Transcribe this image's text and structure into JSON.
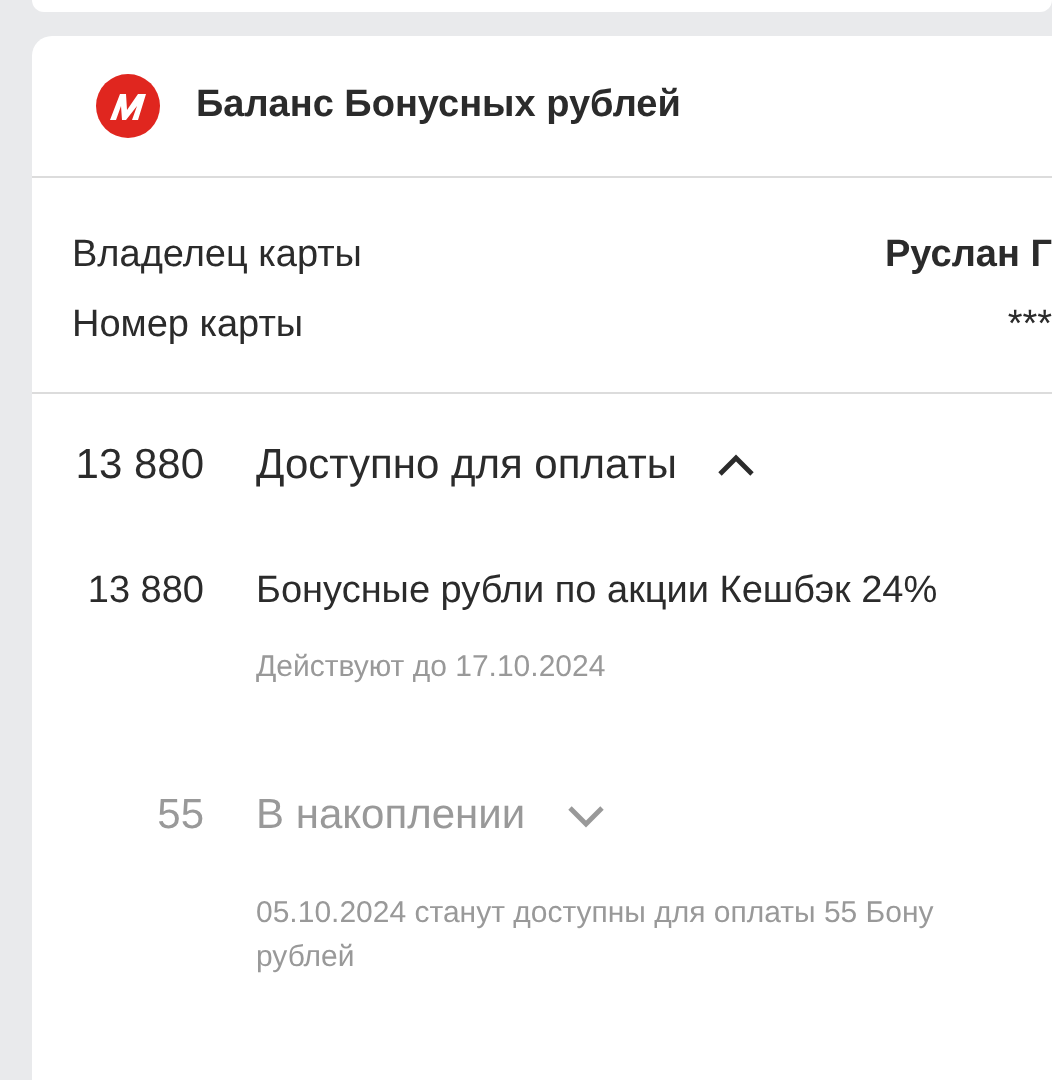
{
  "header": {
    "title": "Баланс Бонусных рублей"
  },
  "card_info": [
    {
      "label": "Владелец карты",
      "value": "Руслан Г",
      "kind": "bold"
    },
    {
      "label": "Номер карты",
      "value": "***",
      "kind": "plain"
    }
  ],
  "sections": [
    {
      "amount": "13 880",
      "title": "Доступно для оплаты",
      "kind": "available",
      "expanded": true,
      "items": [
        {
          "amount": "13 880",
          "title": "Бонусные рубли по акции Кешбэк 24%",
          "note": "Действуют до 17.10.2024"
        }
      ]
    },
    {
      "amount": "55",
      "title": "В накоплении",
      "kind": "pending",
      "expanded": false,
      "note_lines": [
        "05.10.2024 станут доступны для оплаты 55 Бону",
        "рублей"
      ]
    }
  ]
}
